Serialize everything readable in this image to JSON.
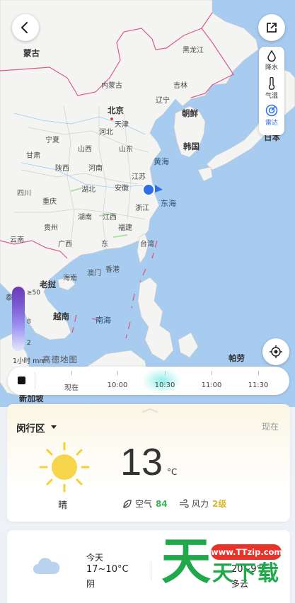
{
  "map": {
    "country_labels": {
      "mongolia": "蒙古",
      "north_korea": "朝鲜",
      "south_korea": "韩国",
      "japan": "日本",
      "palau": "帕劳",
      "singapore": "新加坡",
      "laos": "老挝",
      "vietnam": "越南",
      "cambodia_partial": "泰"
    },
    "province_labels": {
      "heilongjiang": "黑龙江",
      "jilin": "吉林",
      "inner_mongolia": "内蒙古",
      "liaoning": "辽宁",
      "beijing": "北京",
      "tianjin": "天津",
      "hebei": "河北",
      "shandong": "山东",
      "shanxi": "山西",
      "ningxia": "宁夏",
      "gansu": "甘肃",
      "shaanxi": "陕西",
      "henan": "河南",
      "jiangsu": "江苏",
      "anhui": "安徽",
      "sichuan": "四川",
      "hubei": "湖北",
      "zhejiang": "浙江",
      "chongqing": "重庆",
      "guizhou": "贵州",
      "hunan": "湖南",
      "jiangxi": "江西",
      "fujian": "福建",
      "yunnan": "云南",
      "guangxi": "广西",
      "guangdong": "东",
      "taiwan": "台湾",
      "macau": "澳门",
      "hongkong": "香港",
      "hainan": "海南"
    },
    "sea_labels": {
      "yellow_sea": "黄海",
      "east_sea": "东海",
      "south_sea": "南海"
    },
    "layers": [
      {
        "label": "降水",
        "icon": "drop-icon"
      },
      {
        "label": "气温",
        "icon": "thermometer-icon"
      },
      {
        "label": "雷达",
        "icon": "radar-icon"
      }
    ],
    "legend": {
      "ticks": [
        "≥50",
        "8",
        "2"
      ],
      "unit": "1小时 mm"
    },
    "brand": "高德地图"
  },
  "timeline": {
    "labels": [
      "现在",
      "10:00",
      "10:30",
      "11:00",
      "11:30"
    ]
  },
  "weather": {
    "district": "闵行区",
    "now_label": "现在",
    "temperature": "13",
    "unit": "°C",
    "condition": "晴",
    "air_label": "空气",
    "air_value": "84",
    "wind_label": "风力",
    "wind_value": "2级"
  },
  "forecast": [
    {
      "day": "今天",
      "range": "17~10°C",
      "condition": "阴"
    },
    {
      "day": "",
      "range": "20~9°C",
      "condition": "多云"
    }
  ],
  "watermark": {
    "big_char": "天",
    "url": "www.TTzip.com",
    "text": "天下载"
  },
  "colors": {
    "accent": "#2e6ee6",
    "air_good": "#3bb55a",
    "wind": "#d8b82a",
    "sea": "#a8ccf0",
    "land": "#f4f4f2"
  }
}
